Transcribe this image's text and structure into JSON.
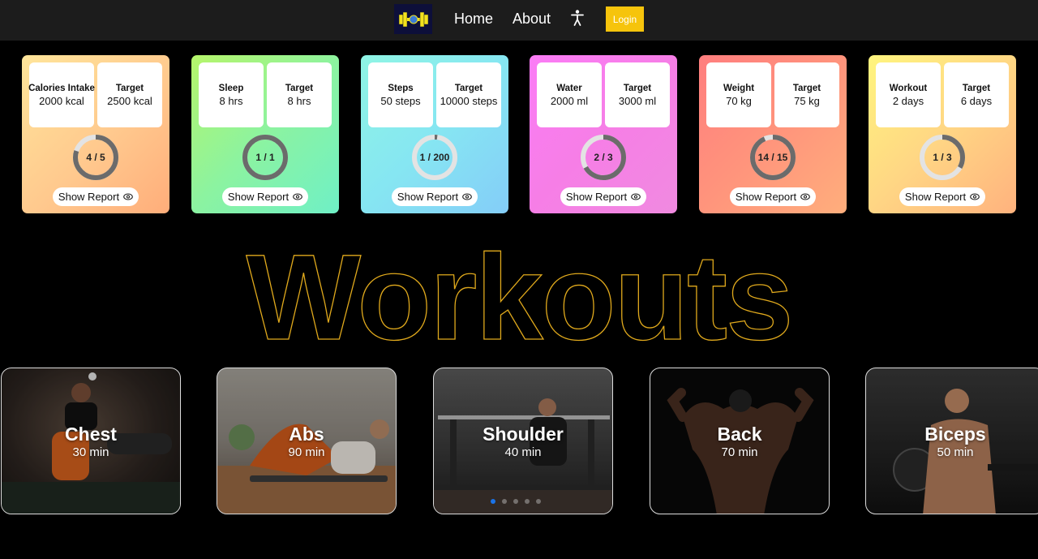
{
  "nav": {
    "logo_icon": "dumbbell-logo-icon",
    "home": "Home",
    "about": "About",
    "accessibility_icon": "accessibility-icon",
    "login": "Login"
  },
  "stats": [
    {
      "label": "Calories Intake",
      "value": "2000 kcal",
      "target_label": "Target",
      "target": "2500 kcal",
      "progress": "4 / 5",
      "fraction": 0.8,
      "report": "Show Report"
    },
    {
      "label": "Sleep",
      "value": "8 hrs",
      "target_label": "Target",
      "target": "8 hrs",
      "progress": "1 / 1",
      "fraction": 1.0,
      "report": "Show Report"
    },
    {
      "label": "Steps",
      "value": "50 steps",
      "target_label": "Target",
      "target": "10000 steps",
      "progress": "1 / 200",
      "fraction": 0.005,
      "report": "Show Report"
    },
    {
      "label": "Water",
      "value": "2000 ml",
      "target_label": "Target",
      "target": "3000 ml",
      "progress": "2 / 3",
      "fraction": 0.667,
      "report": "Show Report"
    },
    {
      "label": "Weight",
      "value": "70 kg",
      "target_label": "Target",
      "target": "75 kg",
      "progress": "14 / 15",
      "fraction": 0.933,
      "report": "Show Report"
    },
    {
      "label": "Workout",
      "value": "2 days",
      "target_label": "Target",
      "target": "6 days",
      "progress": "1 / 3",
      "fraction": 0.333,
      "report": "Show Report"
    }
  ],
  "section_title": "Workouts",
  "workouts": [
    {
      "name": "Chest",
      "time": "30 min"
    },
    {
      "name": "Abs",
      "time": "90 min"
    },
    {
      "name": "Shoulder",
      "time": "40 min"
    },
    {
      "name": "Back",
      "time": "70 min"
    },
    {
      "name": "Biceps",
      "time": "50 min"
    }
  ],
  "carousel": {
    "pages": 5,
    "active_index": 0
  },
  "colors": {
    "accent": "#f6c40c",
    "title_outline": "#e0a91c",
    "ring_fill": "#6b6b6b",
    "ring_track": "#e3e3e3",
    "dot_active": "#1a73e8"
  }
}
